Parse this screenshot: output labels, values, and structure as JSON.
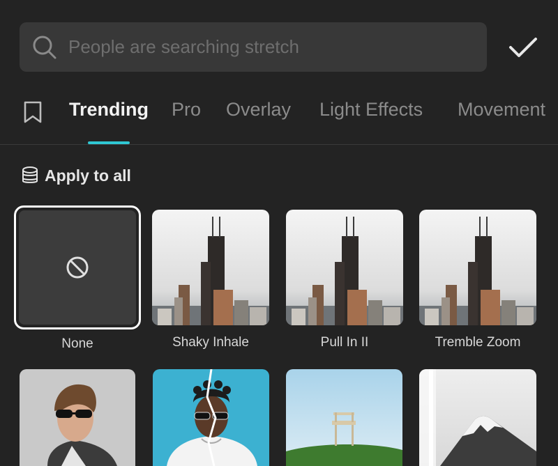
{
  "search": {
    "placeholder": "People are searching stretch",
    "icon": "search-icon"
  },
  "confirm": {
    "icon": "checkmark-icon"
  },
  "tabs": {
    "bookmark_icon": "bookmark-icon",
    "items": [
      {
        "label": "Trending",
        "active": true
      },
      {
        "label": "Pro",
        "active": false
      },
      {
        "label": "Overlay",
        "active": false
      },
      {
        "label": "Light Effects",
        "active": false
      },
      {
        "label": "Movement",
        "active": false
      }
    ],
    "accent_color": "#2fc7d3"
  },
  "apply_all": {
    "label": "Apply to all",
    "icon": "layers-icon"
  },
  "effects": [
    {
      "label": "None",
      "selected": true,
      "icon": "prohibited-icon"
    },
    {
      "label": "Shaky Inhale",
      "selected": false
    },
    {
      "label": "Pull In II",
      "selected": false
    },
    {
      "label": "Tremble Zoom",
      "selected": false
    }
  ]
}
